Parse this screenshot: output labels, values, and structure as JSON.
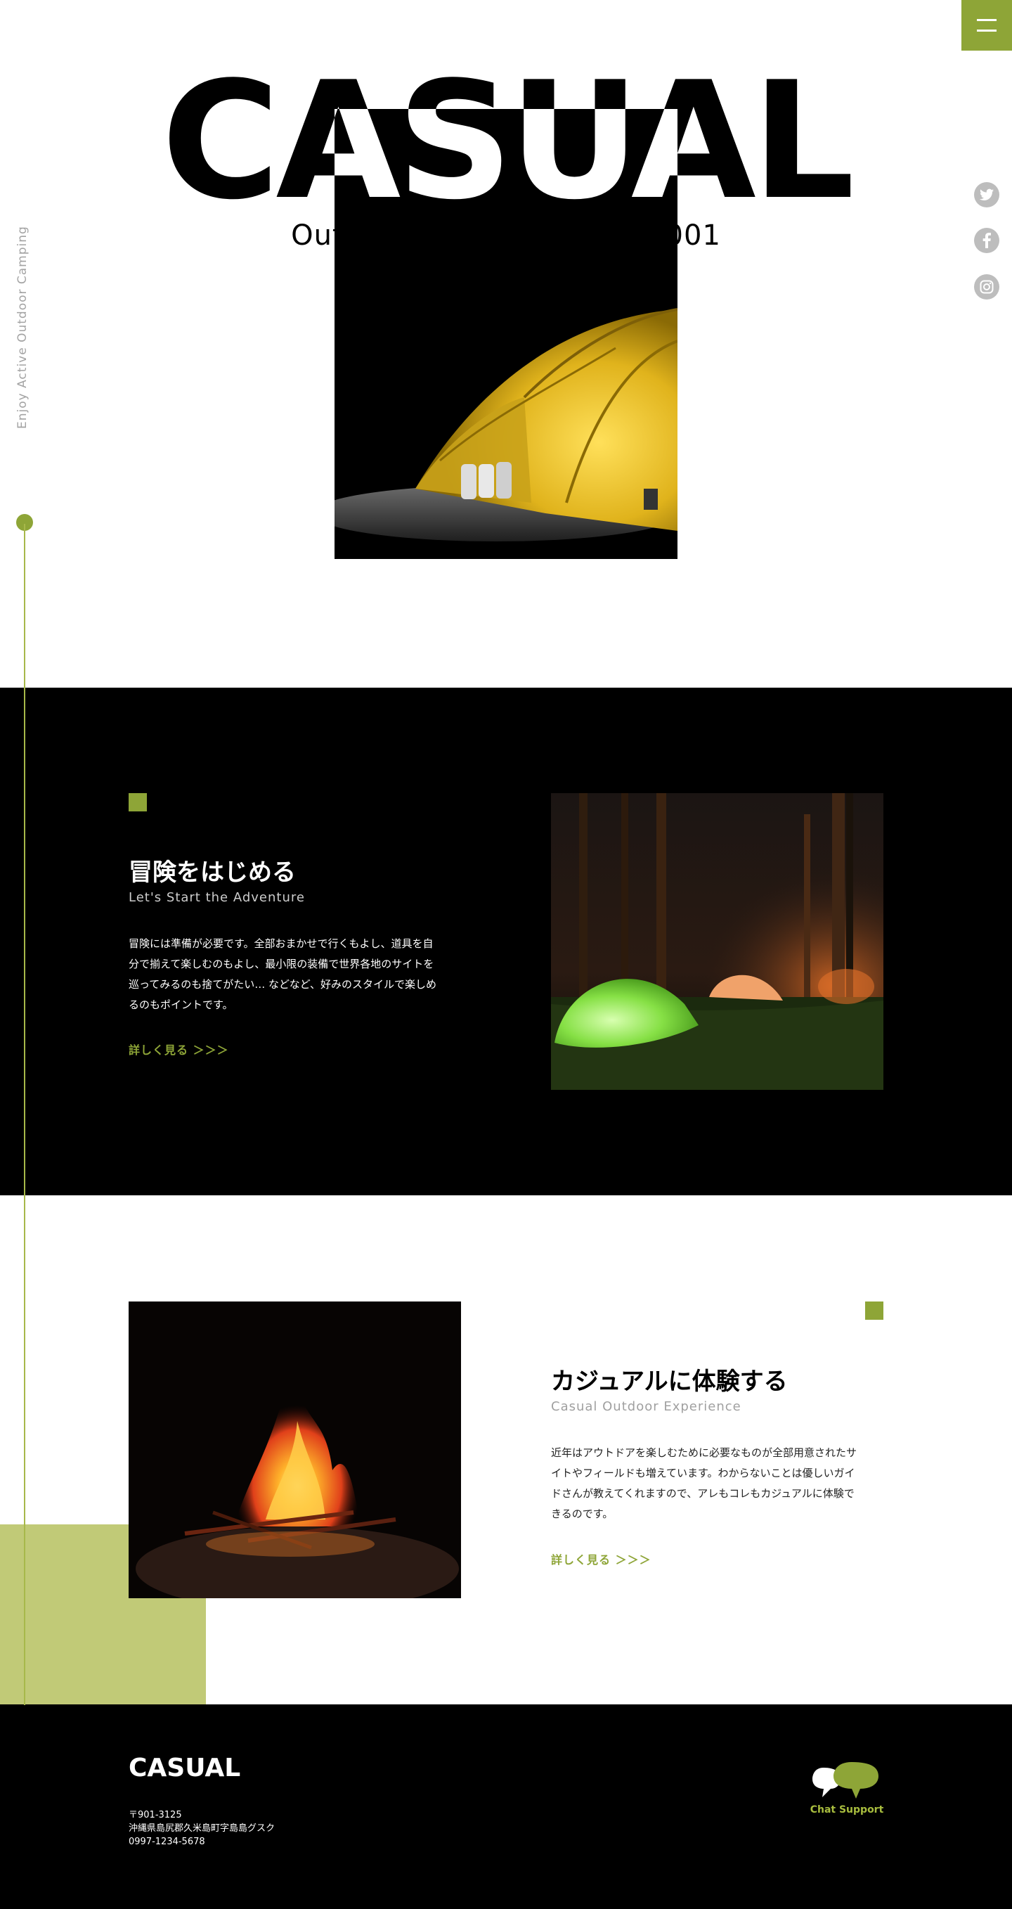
{
  "header": {
    "logo": "CASUAL",
    "tagline": "Outdoor Camping since 2001",
    "vertical_caption": "Enjoy Active Outdoor Camping",
    "menu_icon": "hamburger-menu-icon"
  },
  "social": {
    "items": [
      "twitter-icon",
      "facebook-icon",
      "instagram-icon"
    ]
  },
  "sections": [
    {
      "title": "冒険をはじめる",
      "subtitle": "Let's Start the Adventure",
      "body_lines": [
        "冒険には準備が必要です。全部おまかせで行くもよし、道具を自",
        "分で揃えて楽しむのもよし、最小限の装備で世界各地のサイトを",
        "巡ってみるのも捨てがたい… などなど、好みのスタイルで楽しめ",
        "るのもポイントです。"
      ],
      "link": "詳しく見る ＞＞＞"
    },
    {
      "title": "カジュアルに体験する",
      "subtitle": "Casual Outdoor Experience",
      "body_lines": [
        "近年はアウトドアを楽しむために必要なものが全部用意されたサ",
        "イトやフィールドも増えています。わからないことは優しいガイ",
        "ドさんが教えてくれますので、アレもコレもカジュアルに体験で",
        "きるのです。"
      ],
      "link": "詳しく見る ＞＞＞"
    }
  ],
  "footer": {
    "logo": "CASUAL",
    "address_lines": [
      "〒901-3125",
      "沖縄県島尻郡久米島町字島島グスク",
      "0997-1234-5678"
    ],
    "chat_label": "Chat Support"
  },
  "colors": {
    "accent": "#8ea537",
    "accent_light": "#c1ca77",
    "dark": "#000000"
  }
}
